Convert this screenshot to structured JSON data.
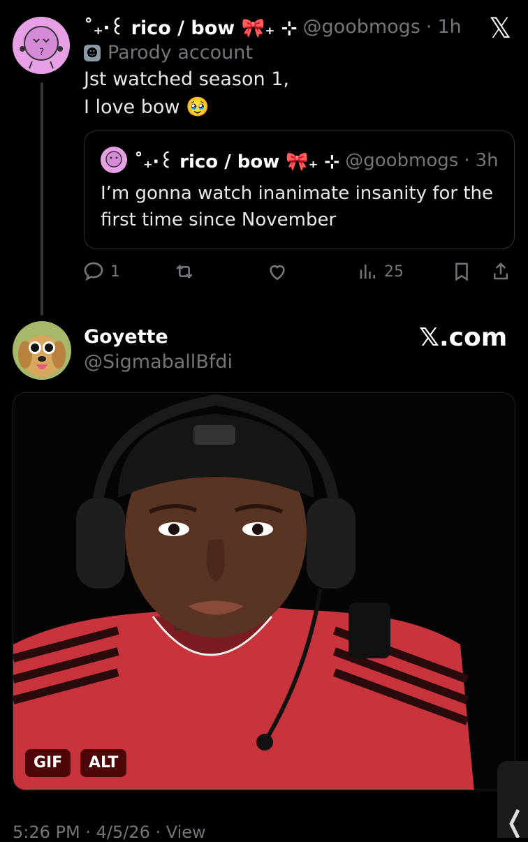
{
  "post": {
    "display_name": "˚₊‧꒰ rico / bow 🎀₊ ⊹",
    "handle": "@goobmogs",
    "time": "1h",
    "label": "Parody account",
    "text_line1": "Jst watched season 1,",
    "text_line2": "I love bow 🥹",
    "quote": {
      "display_name": "˚₊‧꒰ rico / bow 🎀₊ ⊹",
      "handle": "@goobmogs",
      "time": "3h",
      "text_line1": "I’m gonna watch inanimate insanity  for the",
      "text_line2": "first time since November"
    },
    "replies": "1",
    "views": "25"
  },
  "reply": {
    "display_name": "Goyette",
    "handle": "@SigmaballBfdi",
    "brand": "𝕏.com",
    "gif_label": "GIF",
    "alt_label": "ALT",
    "footer": "5:26 PM · 4/5/26 · View"
  },
  "brand_icon": "𝕏",
  "separator": "·",
  "colors": {
    "background": "#000000",
    "muted": "#71767b",
    "avatar_pink": "#e7a0e6",
    "shirt_red": "#c8333c"
  }
}
